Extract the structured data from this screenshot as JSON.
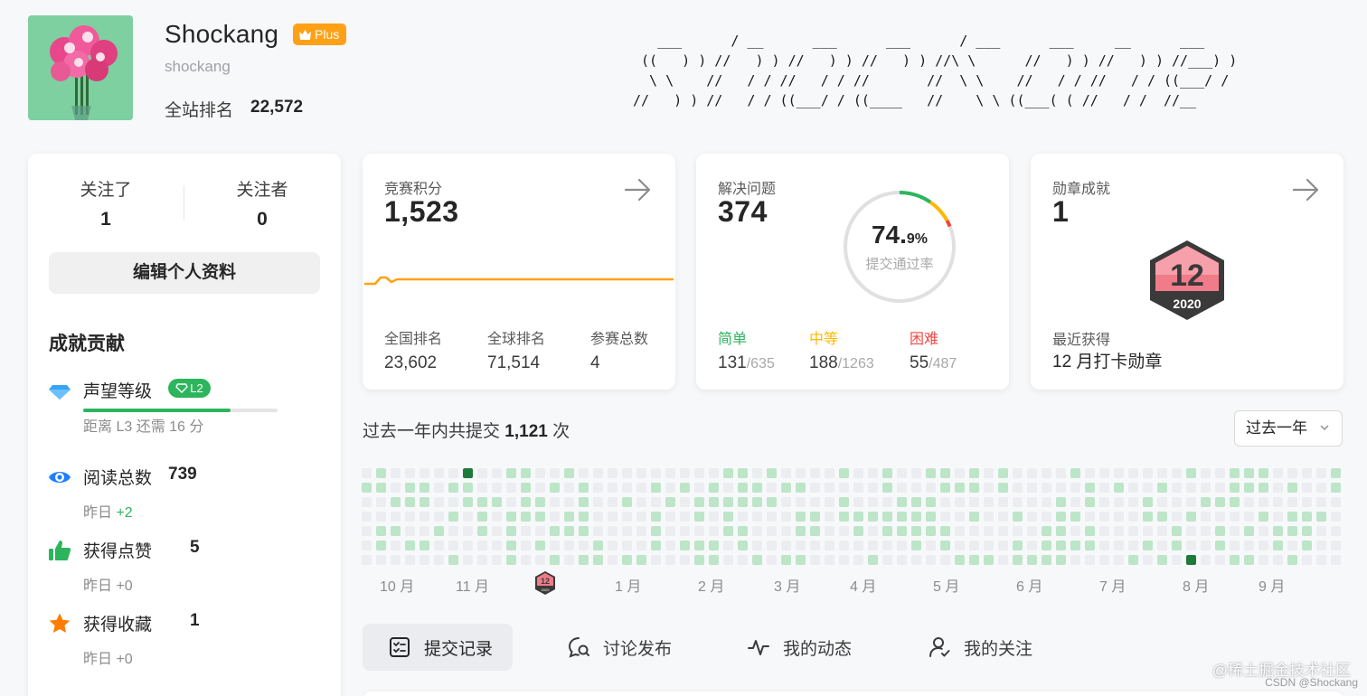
{
  "profile": {
    "display_name": "Shockang",
    "badge": "Plus",
    "handle": "shockang",
    "rank_label": "全站排名",
    "rank_value": "22,572",
    "ascii_art": "   ___      / __      ___      ___      / ___      ___     __      ___\n ((   ) ) //   ) ) //   ) ) //   ) ) //\\ \\      //   ) ) //   ) ) //___) )\n  \\ \\    //   / / //   / / //       //  \\ \\    //   / / //   / / ((___/ /\n//   ) ) //   / / ((___/ / ((____   //    \\ \\ ((___( ( //   / /  //__"
  },
  "sidebar": {
    "following_label": "关注了",
    "following_count": "1",
    "followers_label": "关注者",
    "followers_count": "0",
    "edit_button": "编辑个人资料",
    "section_title": "成就贡献",
    "reputation": {
      "label": "声望等级",
      "level": "L2",
      "progress": 0.76,
      "hint": "距离 L3 还需 16 分"
    },
    "reads": {
      "label": "阅读总数",
      "value": "739",
      "sub_prefix": "昨日 ",
      "sub_delta": "+2"
    },
    "likes": {
      "label": "获得点赞",
      "value": "5",
      "sub_prefix": "昨日 ",
      "sub_delta": "+0"
    },
    "favorites": {
      "label": "获得收藏",
      "value": "1",
      "sub_prefix": "昨日 ",
      "sub_delta": "+0"
    }
  },
  "contest": {
    "title": "竞赛积分",
    "score": "1,523",
    "national_rank_label": "全国排名",
    "national_rank": "23,602",
    "global_rank_label": "全球排名",
    "global_rank": "71,514",
    "attended_label": "参赛总数",
    "attended": "4"
  },
  "solved": {
    "title": "解决问题",
    "count": "374",
    "acceptance_main": "74.",
    "acceptance_decimal": "9%",
    "acceptance_label": "提交通过率",
    "easy_label": "简单",
    "easy_solved": "131",
    "easy_total": "/635",
    "medium_label": "中等",
    "medium_solved": "188",
    "medium_total": "/1263",
    "hard_label": "困难",
    "hard_solved": "55",
    "hard_total": "/487"
  },
  "badges": {
    "title": "勋章成就",
    "count": "1",
    "medal_number": "12",
    "medal_year": "2020",
    "recent_label": "最近获得",
    "recent_value": "12 月打卡勋章"
  },
  "submissions": {
    "title_prefix": "过去一年内共提交 ",
    "title_count": "1,121",
    "title_suffix": " 次",
    "range_selected": "过去一年",
    "months": [
      "10 月",
      "11 月",
      "1 月",
      "2 月",
      "3 月",
      "4 月",
      "5 月",
      "6 月",
      "7 月",
      "8 月",
      "9 月"
    ],
    "month_badge_number": "12",
    "month_badge_year": "2020"
  },
  "tabs": [
    {
      "label": "提交记录",
      "icon": "submission-list-icon",
      "active": true
    },
    {
      "label": "讨论发布",
      "icon": "discussion-icon",
      "active": false
    },
    {
      "label": "我的动态",
      "icon": "activity-pulse-icon",
      "active": false
    },
    {
      "label": "我的关注",
      "icon": "user-check-icon",
      "active": false
    }
  ],
  "watermark": "@稀土掘金技术社区",
  "watermark_sub": "CSDN @Shockang",
  "colors": {
    "accent_orange": "#ffa116",
    "easy_green": "#2db55d",
    "medium_yellow": "#ffb800",
    "hard_red": "#ef4743",
    "heat_empty": "#ebedf0",
    "heat_light": "#bde5c8",
    "heat_dark": "#1f7a3a"
  }
}
